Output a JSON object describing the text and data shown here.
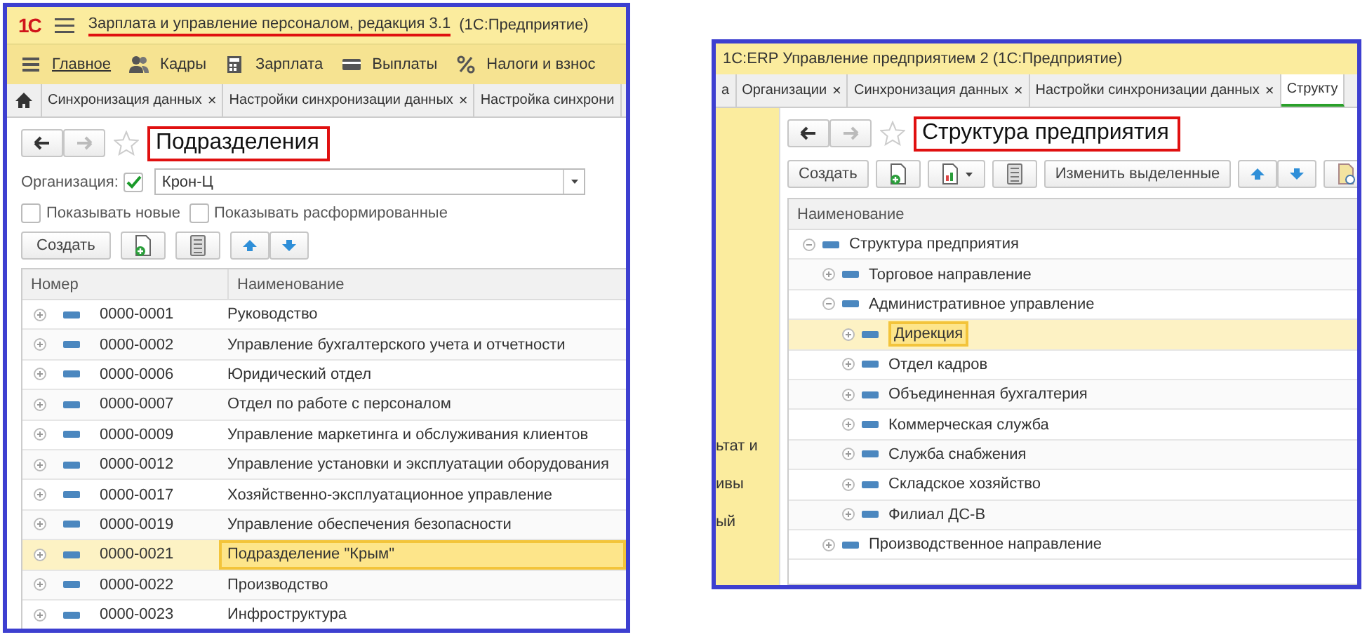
{
  "left_window": {
    "logo": "1С",
    "title": "Зарплата и управление персоналом, редакция 3.1",
    "title_annotated": true,
    "subtitle": "(1С:Предприятие)",
    "menu": [
      {
        "label": "Главное",
        "selected": true
      },
      {
        "label": "Кадры",
        "selected": false
      },
      {
        "label": "Зарплата",
        "selected": false
      },
      {
        "label": "Выплаты",
        "selected": false
      },
      {
        "label": "Налоги и взнос",
        "selected": false
      }
    ],
    "tabs": [
      {
        "label": "Синхронизация данных",
        "close": "×"
      },
      {
        "label": "Настройки синхронизации данных",
        "close": "×"
      },
      {
        "label": "Настройка синхрони"
      }
    ],
    "form_title": "Подразделения",
    "form_title_annotated": true,
    "organization": {
      "label": "Организация:",
      "checked": true,
      "value": "Крон-Ц"
    },
    "options": [
      {
        "label": "Показывать новые",
        "checked": false
      },
      {
        "label": "Показывать расформированные",
        "checked": false
      }
    ],
    "create_button": "Создать",
    "table": {
      "columns": [
        "Номер",
        "Наименование"
      ],
      "rows": [
        {
          "number": "0000-0001",
          "name": "Руководство",
          "selected": false
        },
        {
          "number": "0000-0002",
          "name": "Управление бухгалтерского учета и отчетности",
          "selected": false
        },
        {
          "number": "0000-0006",
          "name": "Юридический отдел",
          "selected": false
        },
        {
          "number": "0000-0007",
          "name": "Отдел по работе с персоналом",
          "selected": false
        },
        {
          "number": "0000-0009",
          "name": "Управление маркетинга и обслуживания клиентов",
          "selected": false
        },
        {
          "number": "0000-0012",
          "name": "Управление установки и эксплуатации оборудования",
          "selected": false
        },
        {
          "number": "0000-0017",
          "name": "Хозяйственно-эксплуатационное управление",
          "selected": false
        },
        {
          "number": "0000-0019",
          "name": "Управление обеспечения безопасности",
          "selected": false
        },
        {
          "number": "0000-0021",
          "name": "Подразделение \"Крым\"",
          "selected": true
        },
        {
          "number": "0000-0022",
          "name": "Производство",
          "selected": false
        },
        {
          "number": "0000-0023",
          "name": "Инфроструктура",
          "selected": false
        }
      ]
    }
  },
  "right_window": {
    "title": "1С:ERP Управление предприятием 2  (1С:Предприятие)",
    "tabs": [
      {
        "label": "а",
        "selected": false
      },
      {
        "label": "Организации",
        "close": "×",
        "selected": false
      },
      {
        "label": "Синхронизация данных",
        "close": "×",
        "selected": false
      },
      {
        "label": "Настройки синхронизации данных",
        "close": "×",
        "selected": false
      },
      {
        "label": "Структу",
        "selected": true
      }
    ],
    "sidebar": {
      "items": [
        "ьтат и",
        "ивы",
        "ый"
      ]
    },
    "form_title": "Структура предприятия",
    "form_title_annotated": true,
    "create_button": "Создать",
    "edit_selected_button": "Изменить выделенные",
    "tree": {
      "column": "Наименование",
      "nodes": [
        {
          "name": "Структура предприятия",
          "expanded": true,
          "selected": false,
          "children": [
            {
              "name": "Торговое направление",
              "expanded": false,
              "selected": false
            },
            {
              "name": "Административное управление",
              "expanded": true,
              "selected": false,
              "children": [
                {
                  "name": "Дирекция",
                  "expanded": false,
                  "selected": true
                },
                {
                  "name": "Отдел кадров",
                  "expanded": false,
                  "selected": false
                },
                {
                  "name": "Объединенная бухгалтерия",
                  "expanded": false,
                  "selected": false
                },
                {
                  "name": "Коммерческая служба",
                  "expanded": false,
                  "selected": false
                },
                {
                  "name": "Служба снабжения",
                  "expanded": false,
                  "selected": false
                },
                {
                  "name": "Складское хозяйство",
                  "expanded": false,
                  "selected": false
                },
                {
                  "name": "Филиал ДС-В",
                  "expanded": false,
                  "selected": false
                }
              ]
            },
            {
              "name": "Производственное направление",
              "expanded": false,
              "selected": false
            }
          ]
        }
      ]
    }
  }
}
